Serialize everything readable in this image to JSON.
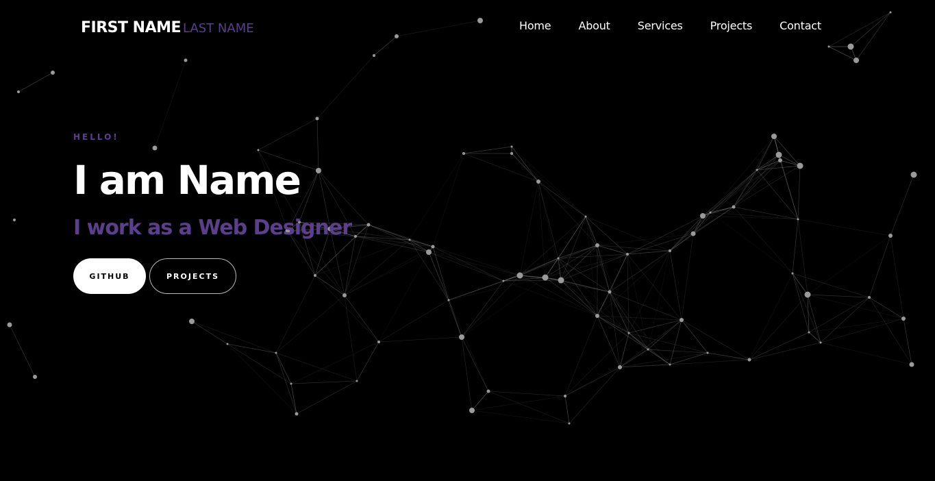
{
  "brand": {
    "first_name": "FIRST NAME",
    "last_name": "LAST NAME"
  },
  "nav": {
    "items": [
      {
        "label": "Home"
      },
      {
        "label": "About"
      },
      {
        "label": "Services"
      },
      {
        "label": "Projects"
      },
      {
        "label": "Contact"
      }
    ]
  },
  "hero": {
    "greeting": "HELLO!",
    "title": "I am Name",
    "subtitle": "I work as a Web Designer",
    "buttons": {
      "github": "GITHUB",
      "projects": "PROJECTS"
    }
  },
  "colors": {
    "background": "#000000",
    "accent": "#5b3f8c",
    "text": "#ffffff",
    "network": "#9a9a9a"
  }
}
